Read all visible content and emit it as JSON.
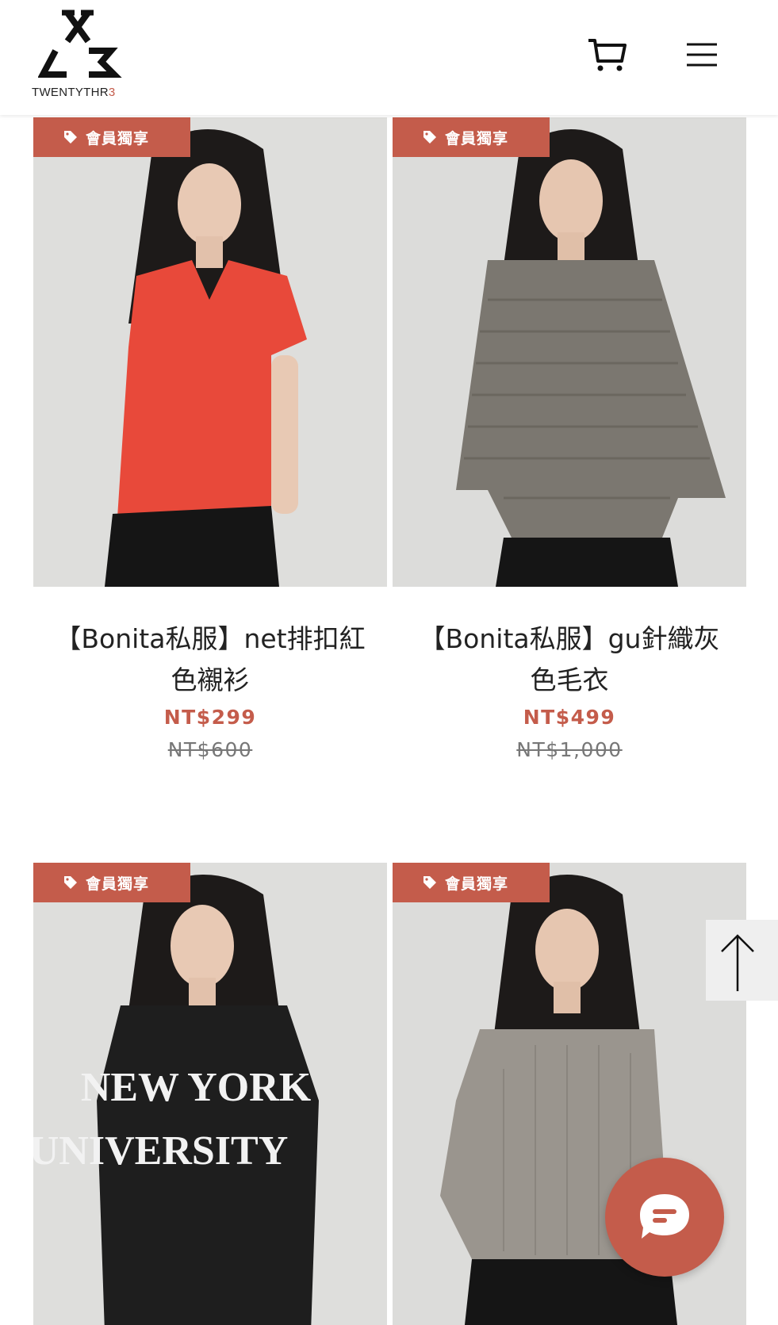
{
  "brand": {
    "name_main": "TWENTYTHR",
    "name_accent": "3",
    "accent_color": "#c45c4b"
  },
  "header": {
    "cart_icon": "cart-icon",
    "menu_icon": "hamburger-menu-icon"
  },
  "products": [
    {
      "badge": "會員獨享",
      "name": "【Bonita私服】net排扣紅色襯衫",
      "price": "NT$299",
      "original_price": "NT$600",
      "garment_color": "#e8493a"
    },
    {
      "badge": "會員獨享",
      "name": "【Bonita私服】gu針織灰色毛衣",
      "price": "NT$499",
      "original_price": "NT$1,000",
      "garment_color": "#7b7770"
    },
    {
      "badge": "會員獨享",
      "sweatshirt_print": [
        "NEW YORK",
        "UNIVERSITY"
      ],
      "garment_color": "#1e1e1e"
    },
    {
      "badge": "會員獨享",
      "garment_color": "#9a958e"
    }
  ],
  "floating": {
    "scroll_top_icon": "arrow-up-icon",
    "chat_icon": "chat-bubble-icon"
  }
}
